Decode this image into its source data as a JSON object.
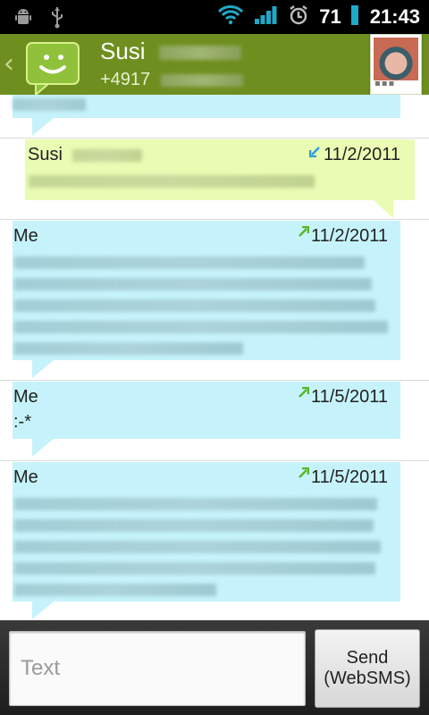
{
  "status_bar": {
    "battery_percent": "71",
    "time": "21:43",
    "icons": [
      "android-debug-icon",
      "usb-icon",
      "wifi-icon",
      "signal-icon",
      "alarm-icon",
      "battery-icon"
    ]
  },
  "header": {
    "contact_name": "Susi",
    "phone_prefix": "+4917",
    "icons": [
      "back-chevron-icon",
      "messaging-app-icon",
      "contact-avatar"
    ]
  },
  "messages": [
    {
      "sender": "Susi",
      "date": "11/2/2011",
      "direction": "incoming",
      "text": ""
    },
    {
      "sender": "Me",
      "date": "11/2/2011",
      "direction": "outgoing",
      "text": ""
    },
    {
      "sender": "Me",
      "date": "11/5/2011",
      "direction": "outgoing",
      "text": ":-*"
    },
    {
      "sender": "Me",
      "date": "11/5/2011",
      "direction": "outgoing",
      "text": ""
    }
  ],
  "composer": {
    "placeholder": "Text",
    "send_label_line1": "Send",
    "send_label_line2": "(WebSMS)"
  },
  "colors": {
    "header": "#6e8f1f",
    "outgoing_bubble": "#c6f3fb",
    "incoming_bubble": "#eafbb3",
    "status_accent": "#1fa9c8"
  }
}
